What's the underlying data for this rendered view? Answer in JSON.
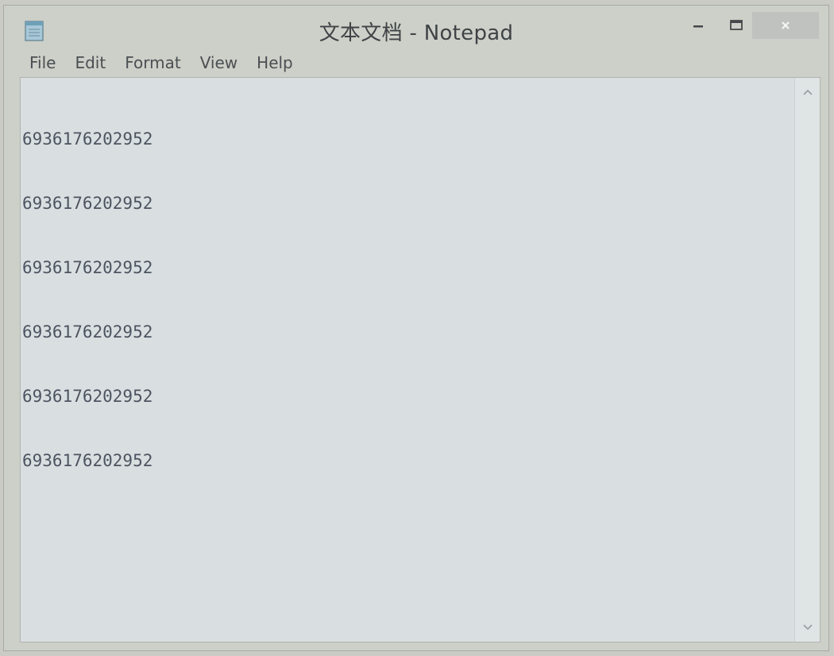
{
  "window": {
    "title": "文本文档 - Notepad",
    "icon": "notepad-icon"
  },
  "controls": {
    "minimize_icon": "minimize-icon",
    "maximize_icon": "maximize-icon",
    "close_icon": "close-icon"
  },
  "menu": {
    "items": [
      {
        "label": "File"
      },
      {
        "label": "Edit"
      },
      {
        "label": "Format"
      },
      {
        "label": "View"
      },
      {
        "label": "Help"
      }
    ]
  },
  "editor": {
    "lines": [
      "6936176202952",
      "6936176202952",
      "6936176202952",
      "6936176202952",
      "6936176202952",
      "6936176202952"
    ]
  },
  "scrollbar": {
    "up_icon": "chevron-up-icon",
    "down_icon": "chevron-down-icon"
  },
  "colors": {
    "window_bg": "#cdd0c8",
    "editor_bg": "#d9dfe1",
    "text": "#4d5460"
  }
}
